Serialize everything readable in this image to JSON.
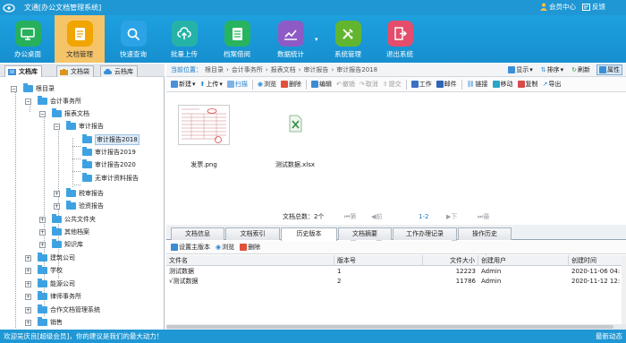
{
  "app": {
    "title": "文通[办公文档管理系统]",
    "user_center": "会员中心",
    "feedback": "反馈"
  },
  "toolbar": [
    {
      "label": "办公桌面",
      "icon": "desktop-icon",
      "color": "#27b05c"
    },
    {
      "label": "文档管理",
      "icon": "document-icon",
      "color": "#f0a500",
      "active": true
    },
    {
      "label": "快速查询",
      "icon": "search-icon",
      "color": "#2ba3e6"
    },
    {
      "label": "批量上传",
      "icon": "upload-icon",
      "color": "#25b3a7"
    },
    {
      "label": "档案借阅",
      "icon": "archive-icon",
      "color": "#28b45e"
    },
    {
      "label": "数据统计",
      "icon": "chart-icon",
      "color": "#8e5bc6"
    },
    {
      "label": "系统管理",
      "icon": "tools-icon",
      "color": "#62b62f"
    },
    {
      "label": "退出系统",
      "icon": "exit-icon",
      "color": "#e44d6b"
    }
  ],
  "left_tabs": [
    {
      "label": "文档库",
      "active": true
    },
    {
      "label": "文档袋"
    },
    {
      "label": "云档库"
    }
  ],
  "tree": [
    {
      "label": "根目录",
      "expanded": true
    },
    {
      "label": "会计事务所",
      "expanded": true
    },
    {
      "label": "报表文档",
      "expanded": true
    },
    {
      "label": "审计报告",
      "expanded": true
    },
    {
      "label": "审计报告2018",
      "selected": true
    },
    {
      "label": "审计报告2019"
    },
    {
      "label": "审计报告2020"
    },
    {
      "label": "无审计资料报告"
    },
    {
      "label": "税审报告"
    },
    {
      "label": "验资报告"
    },
    {
      "label": "公共文件夹"
    },
    {
      "label": "其他档案"
    },
    {
      "label": "知识库"
    },
    {
      "label": "建筑公司"
    },
    {
      "label": "学校"
    },
    {
      "label": "能源公司"
    },
    {
      "label": "律师事务所"
    },
    {
      "label": "合作文档管理系统"
    },
    {
      "label": "销售"
    }
  ],
  "breadcrumb": {
    "label": "当前位置：",
    "items": [
      "根目录",
      "会计事务所",
      "报表文档",
      "审计报告",
      "审计报告2018"
    ],
    "view": "显示",
    "sort": "排序",
    "refresh": "刷新",
    "properties": "属性"
  },
  "actions": [
    "新建",
    "上传",
    "扫描",
    "浏览",
    "删除",
    "编辑",
    "撤销",
    "取消",
    "提交",
    "工作",
    "邮件",
    "链接",
    "移动",
    "复制",
    "导出"
  ],
  "files": [
    {
      "name": "发票.png"
    },
    {
      "name": "测试数据.xlsx"
    }
  ],
  "pager": {
    "total": "文档总数：2个",
    "first": "第一页",
    "prev": "前一页",
    "page": "1-2",
    "next": "下一页",
    "last": "最后一页"
  },
  "bottom_tabs": [
    "文档信息",
    "文档索引",
    "历史版本",
    "文档摘要",
    "工作办理记录",
    "操作历史"
  ],
  "active_bottom_tab": 2,
  "sub_actions": [
    "设置主版本",
    "浏览",
    "删除"
  ],
  "grid": {
    "columns": [
      "文件名",
      "版本号",
      "文件大小",
      "创建用户",
      "创建时间"
    ],
    "rows": [
      {
        "name": "测试数据",
        "version": "1",
        "size": "12223",
        "user": "Admin",
        "time": "2020-11-06 04:"
      },
      {
        "name": "√测试数据",
        "version": "2",
        "size": "11786",
        "user": "Admin",
        "time": "2020-11-12 12:"
      }
    ]
  },
  "status": {
    "message": "欢迎吴庆良[超级会员]，你的建议是我们的最大动力！",
    "news": "最新动态"
  }
}
